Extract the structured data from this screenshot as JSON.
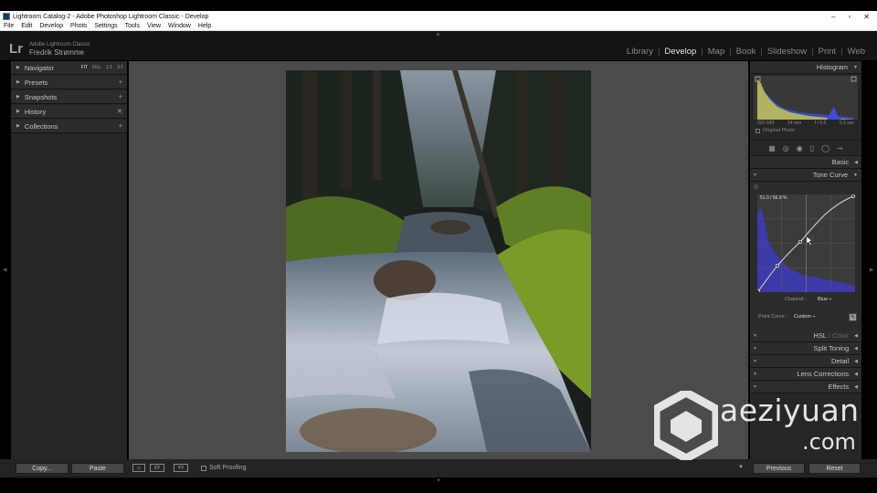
{
  "window": {
    "title": "Lightroom Catalog-2 - Adobe Photoshop Lightroom Classic - Develop",
    "controls": [
      "–",
      "▫",
      "✕"
    ]
  },
  "menu": [
    "File",
    "Edit",
    "Develop",
    "Photo",
    "Settings",
    "Tools",
    "View",
    "Window",
    "Help"
  ],
  "identity": {
    "logo": "Lr",
    "product": "Adobe Lightroom Classic",
    "owner": "Fredrik Strømme"
  },
  "modules": [
    "Library",
    "Develop",
    "Map",
    "Book",
    "Slideshow",
    "Print",
    "Web"
  ],
  "active_module": "Develop",
  "left_panel": {
    "navigator": {
      "label": "Navigator",
      "zoom": [
        "FIT",
        "FILL",
        "1:1",
        "3:1"
      ]
    },
    "items": [
      {
        "label": "Presets",
        "action": "+"
      },
      {
        "label": "Snapshots",
        "action": "+"
      },
      {
        "label": "History",
        "action": "✕"
      },
      {
        "label": "Collections",
        "action": "+"
      }
    ]
  },
  "histogram": {
    "label": "Histogram",
    "info": [
      "ISO 640",
      "24 mm",
      "f / 5.6",
      "0.3 sec"
    ],
    "original_photo": "Original Photo"
  },
  "right_panel": {
    "basic": "Basic",
    "tone_curve": "Tone Curve",
    "readout": "51.0 / 56.9 %",
    "channel_label": "Channel :",
    "channel_value": "Blue ÷",
    "point_curve_label": "Point Curve :",
    "point_curve_value": "Custom ÷",
    "hsl": "HSL",
    "hsl_sep": "/",
    "color": "Color",
    "split_toning": "Split Toning",
    "detail": "Detail",
    "lens_corrections": "Lens Corrections",
    "effects": "Effects"
  },
  "bottom_bar": {
    "copy": "Copy...",
    "paste": "Paste",
    "soft_proofing": "Soft Proofing",
    "previous": "Previous",
    "reset": "Reset",
    "view_xy": "XY",
    "view_yy": "YY"
  },
  "watermark": {
    "line1": "aeziyuan",
    "line2": ".com"
  },
  "colors": {
    "panel_bg": "#262626",
    "center_bg": "#4b4b4b",
    "curve_fill": "#3c3aa8",
    "histo_yellow": "#d8d640",
    "histo_blue": "#3a4fd8"
  }
}
